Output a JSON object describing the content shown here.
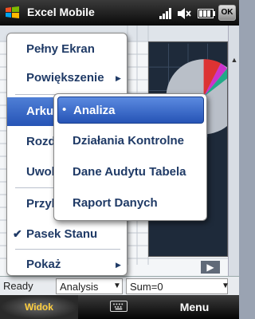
{
  "titlebar": {
    "app_title": "Excel Mobile",
    "start_icon": "windows-logo-icon",
    "signal_icon": "signal-strength-icon",
    "volume_icon": "speaker-muted-icon",
    "battery_icon": "battery-icon",
    "ok_label": "OK"
  },
  "main_menu": {
    "items": [
      {
        "label": "Pełny Ekran",
        "has_submenu": false,
        "checked": false,
        "selected": false
      },
      {
        "label": "Powiększenie",
        "has_submenu": true,
        "checked": false,
        "selected": false
      },
      {
        "label": "Arkusz",
        "has_submenu": true,
        "checked": false,
        "selected": true
      },
      {
        "label": "Rozdziel",
        "has_submenu": false,
        "checked": false,
        "selected": false
      },
      {
        "label": "Uwolnij",
        "has_submenu": false,
        "checked": false,
        "selected": false
      },
      {
        "label": "Przybliż",
        "has_submenu": false,
        "checked": false,
        "selected": false
      },
      {
        "label": "Pasek Stanu",
        "has_submenu": false,
        "checked": true,
        "selected": false
      },
      {
        "label": "Pokaż",
        "has_submenu": true,
        "checked": false,
        "selected": false
      }
    ]
  },
  "sub_menu": {
    "items": [
      {
        "label": "Analiza",
        "selected": true
      },
      {
        "label": "Działania Kontrolne",
        "selected": false
      },
      {
        "label": "Dane Audytu Tabela",
        "selected": false
      },
      {
        "label": "Raport Danych",
        "selected": false
      }
    ]
  },
  "status_bar": {
    "ready": "Ready",
    "sheet_select": "Analysis",
    "sum": "Sum=0"
  },
  "softkeys": {
    "left": "Widok",
    "center_icon": "keyboard-icon",
    "right": "Menu"
  },
  "colors": {
    "menu_text": "#1f3a66",
    "highlight": "#2654b6",
    "softkey_left_text": "#ffcf3f"
  }
}
